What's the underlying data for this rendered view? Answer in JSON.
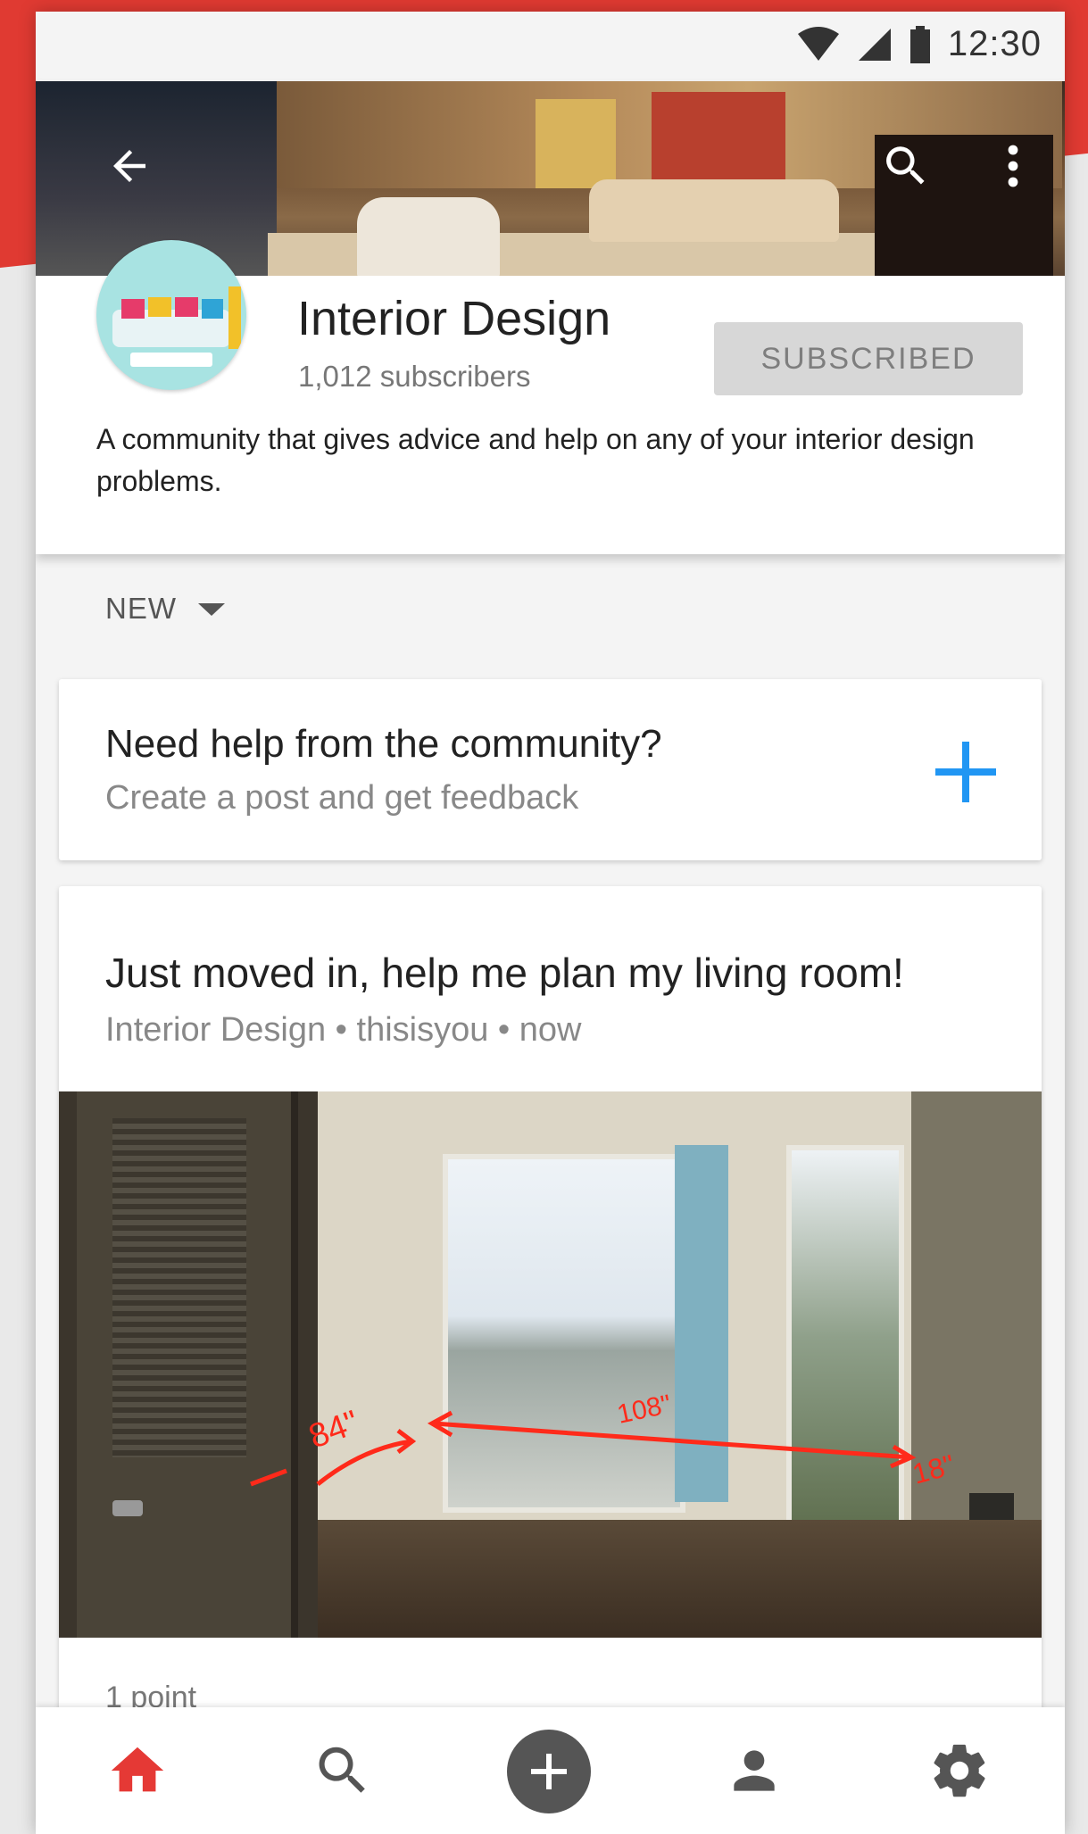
{
  "status_bar": {
    "time": "12:30"
  },
  "community": {
    "title": "Interior Design",
    "subscribers": "1,012 subscribers",
    "subscribe_button": "SUBSCRIBED",
    "description": "A community that gives advice and help on any of your interior design problems."
  },
  "sort": {
    "label": "NEW"
  },
  "create_post": {
    "title": "Need help from the community?",
    "subtitle": "Create a post and get feedback"
  },
  "post": {
    "title": "Just moved in, help me plan my living room!",
    "meta": "Interior Design • thisisyou • now",
    "points": "1 point",
    "image_annotations": [
      "84\"",
      "108\"",
      "18\""
    ]
  },
  "colors": {
    "accent": "#e03a32",
    "plus_blue": "#2196f3",
    "nav_active": "#e53935",
    "nav_inactive": "#555555"
  },
  "icons": {
    "back": "arrow-back-icon",
    "search": "search-icon",
    "more": "more-vert-icon",
    "sort": "caret-down-icon",
    "create": "plus-icon",
    "nav": [
      "home-icon",
      "search-icon",
      "add-circle-icon",
      "person-icon",
      "settings-icon"
    ]
  }
}
